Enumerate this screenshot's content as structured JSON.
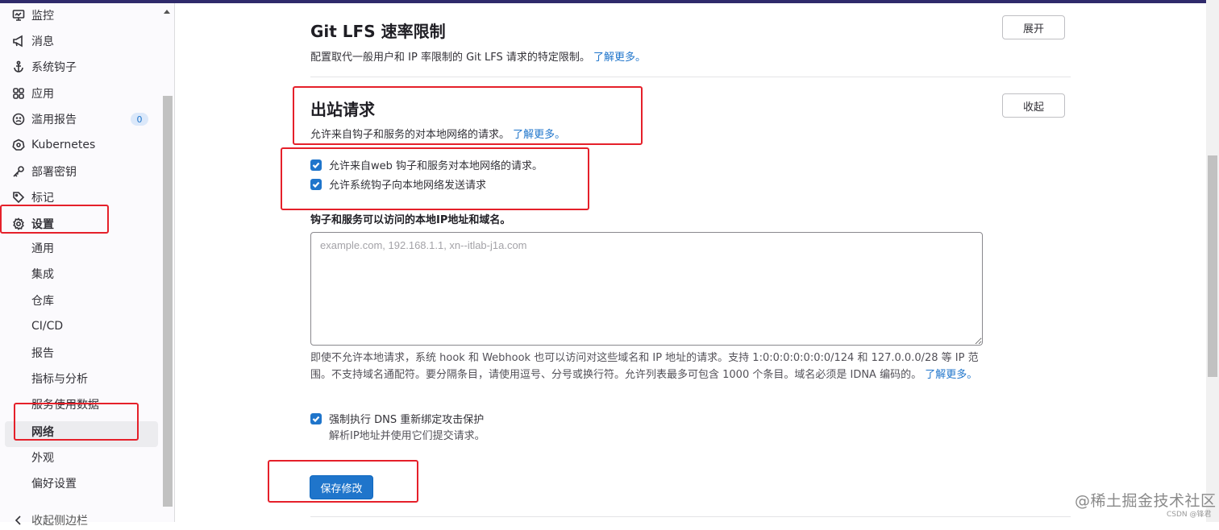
{
  "sidebar": {
    "items": [
      {
        "label": "监控",
        "icon": "monitor-icon"
      },
      {
        "label": "消息",
        "icon": "bullhorn-icon"
      },
      {
        "label": "系统钩子",
        "icon": "anchor-icon"
      },
      {
        "label": "应用",
        "icon": "applications-icon"
      },
      {
        "label": "滥用报告",
        "icon": "abuse-report-icon",
        "badge": "0"
      },
      {
        "label": "Kubernetes",
        "icon": "kubernetes-icon"
      },
      {
        "label": "部署密钥",
        "icon": "key-icon"
      },
      {
        "label": "标记",
        "icon": "label-icon"
      },
      {
        "label": "设置",
        "icon": "settings-icon"
      }
    ],
    "settings_sub": [
      "通用",
      "集成",
      "仓库",
      "CI/CD",
      "报告",
      "指标与分析",
      "服务使用数据",
      "网络",
      "外观",
      "偏好设置"
    ],
    "active_sub": "网络",
    "bottom_partial": "收起侧边栏"
  },
  "git_lfs": {
    "title": "Git LFS 速率限制",
    "description": "配置取代一般用户和 IP 率限制的 Git LFS 请求的特定限制。",
    "learn_more": "了解更多。",
    "expand_button": "展开"
  },
  "outbound": {
    "title": "出站请求",
    "description": "允许来自钩子和服务的对本地网络的请求。",
    "learn_more": "了解更多。",
    "collapse_button": "收起",
    "checkbox_web_hooks": "允许来自web 钩子和服务对本地网络的请求。",
    "checkbox_system_hooks": "允许系统钩子向本地网络发送请求",
    "allowlist_label": "钩子和服务可以访问的本地IP地址和域名。",
    "allowlist_placeholder": "example.com, 192.168.1.1, xn--itlab-j1a.com",
    "allowlist_value": "",
    "help_text": "即使不允许本地请求，系统 hook 和 Webhook 也可以访问对这些域名和 IP 地址的请求。支持 1:0:0:0:0:0:0:0/124 和 127.0.0.0/28 等 IP 范围。不支持域名通配符。要分隔条目，请使用逗号、分号或换行符。允许列表最多可包含 1000 个条目。域名必须是 IDNA 编码的。",
    "help_learn_more": "了解更多。",
    "dns_checkbox": "强制执行 DNS 重新绑定攻击保护",
    "dns_help": "解析IP地址并使用它们提交请求。",
    "save_button": "保存修改"
  },
  "checkbox_states": {
    "web_hooks": true,
    "system_hooks": true,
    "dns_rebinding": true
  },
  "watermark": "@稀土掘金技术社区",
  "watermark_small": "CSDN @锋君",
  "colors": {
    "accent": "#1f75cb",
    "annotation": "#e5202a",
    "topbar": "#2f2a6b"
  }
}
